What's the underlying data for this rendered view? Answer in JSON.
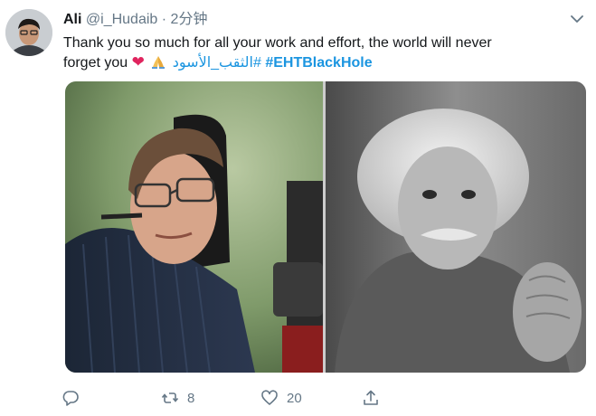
{
  "tweet": {
    "author_name": "Ali",
    "author_handle": "@i_Hudaib",
    "separator": "·",
    "time": "2分钟",
    "text_line1": "Thank you so much for all your work and effort, the world will never",
    "text_line2_prefix": "forget you",
    "heart_emoji": "❤",
    "hashtag_arabic": "#الثقب_الأسود",
    "hashtag_english": "#EHTBlackHole"
  },
  "actions": {
    "reply_count": "",
    "retweet_count": "8",
    "like_count": "20"
  },
  "icons": [
    "chevron-down-icon",
    "reply-icon",
    "retweet-icon",
    "like-icon",
    "share-icon"
  ],
  "colors": {
    "link": "#1b95e0",
    "meta": "#657786",
    "heart": "#e0245e"
  }
}
